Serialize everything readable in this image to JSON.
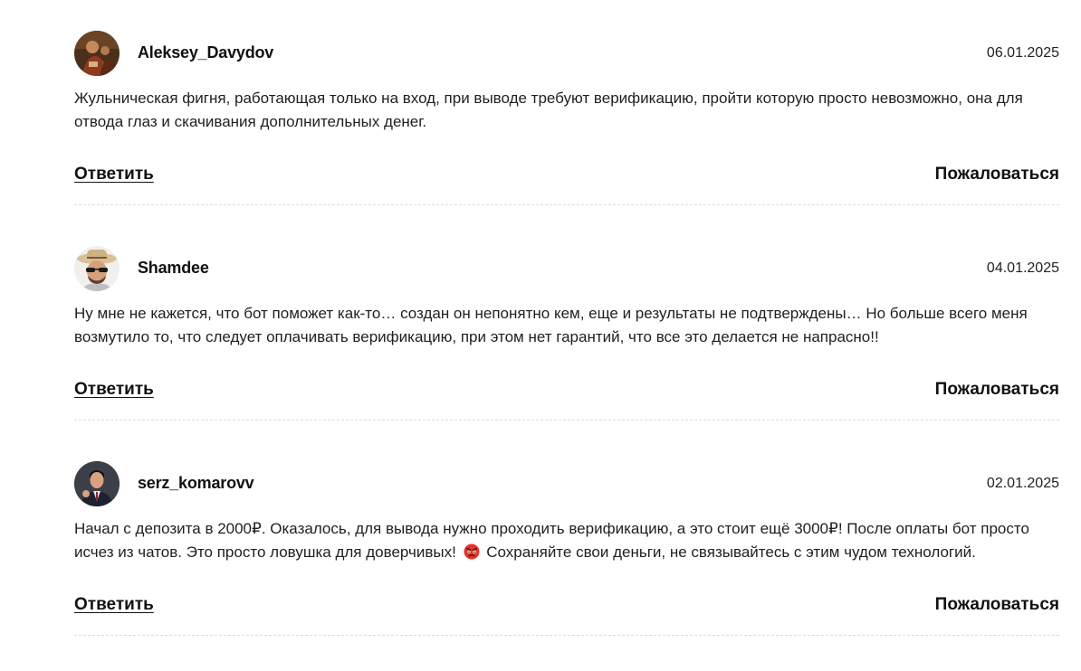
{
  "comments": [
    {
      "username": "Aleksey_Davydov",
      "date": "06.01.2025",
      "text": "Жульническая фигня, работающая только на вход, при выводе требуют верификацию, пройти которую просто невозможно, она для отвода глаз и скачивания дополнительных денег.",
      "reply_label": "Ответить",
      "report_label": "Пожаловаться",
      "avatar_icon": "painting-avatar-icon"
    },
    {
      "username": "Shamdee",
      "date": "04.01.2025",
      "text": "Ну мне не кажется, что бот поможет как-то… создан он непонятно кем, еще и результаты не подтверждены… Но больше всего меня возмутило то, что следует оплачивать верификацию, при этом нет гарантий, что все это делается не напрасно!!",
      "reply_label": "Ответить",
      "report_label": "Пожаловаться",
      "avatar_icon": "man-with-hat-avatar-icon"
    },
    {
      "username": "serz_komarovv",
      "date": "02.01.2025",
      "text_before_emoji": "Начал с депозита в 2000₽. Оказалось, для вывода нужно проходить верификацию, а это стоит ещё 3000₽! После оплаты бот просто исчез из чатов. Это просто ловушка для доверчивых!",
      "emoji_icon": "angry-face-icon",
      "text_after_emoji": "Сохраняйте свои деньги, не связывайтесь с этим чудом технологий.",
      "reply_label": "Ответить",
      "report_label": "Пожаловаться",
      "avatar_icon": "man-in-suit-avatar-icon"
    }
  ],
  "colors": {
    "text": "#1f1f1f",
    "divider": "#dcdcdc",
    "emoji": "#e0352b"
  }
}
